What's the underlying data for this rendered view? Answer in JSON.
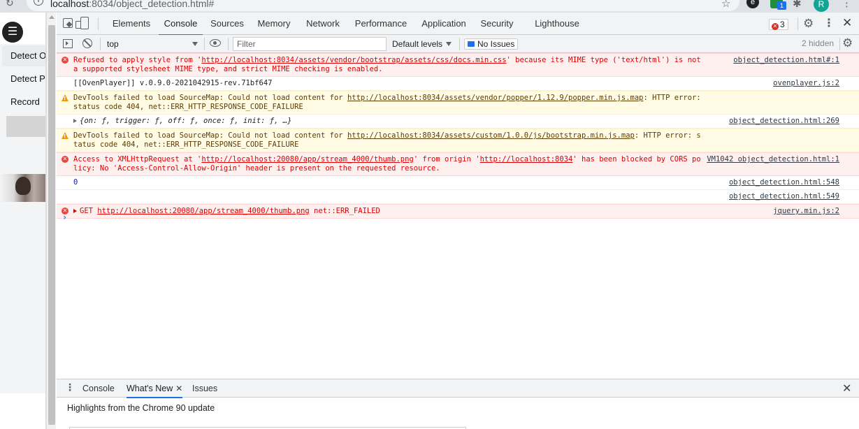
{
  "browser": {
    "url_host": "localhost",
    "url_path": ":8034/object_detection.html#",
    "profile_initial": "R",
    "extension_badge": "1"
  },
  "page": {
    "menu_items": [
      "Detect O",
      "Detect Pe",
      "Record"
    ]
  },
  "devtools": {
    "tabs": [
      "Elements",
      "Console",
      "Sources",
      "Memory",
      "Network",
      "Performance",
      "Application",
      "Security",
      "Lighthouse"
    ],
    "active_tab": "Console",
    "error_count": "3",
    "toolbar": {
      "context": "top",
      "filter_placeholder": "Filter",
      "levels": "Default levels",
      "issues": "No Issues",
      "hidden": "2 hidden"
    },
    "messages": [
      {
        "level": "error",
        "parts": [
          "Refused to apply style from '",
          "http://localhost:8034/assets/vendor/bootstrap/assets/css/docs.min.css",
          "' because its MIME type ('text/html') is not a supported stylesheet MIME type, and strict MIME checking is enabled."
        ],
        "source": "object_detection.html#:1"
      },
      {
        "level": "log",
        "parts": [
          "[[OvenPlayer]] v.0.9.0-2021042915-rev.71bf647"
        ],
        "source": "ovenplayer.js:2"
      },
      {
        "level": "warn",
        "parts": [
          "DevTools failed to load SourceMap: Could not load content for ",
          "http://localhost:8034/assets/vendor/popper/1.12.9/popper.min.js.map",
          ": HTTP error: status code 404, net::ERR_HTTP_RESPONSE_CODE_FAILURE"
        ],
        "source": ""
      },
      {
        "level": "object",
        "parts": [
          "{on: ƒ, trigger: ƒ, off: ƒ, once: ƒ, init: ƒ, …}"
        ],
        "source": "object_detection.html:269"
      },
      {
        "level": "warn",
        "parts": [
          "DevTools failed to load SourceMap: Could not load content for ",
          "http://localhost:8034/assets/custom/1.0.0/js/bootstrap.min.js.map",
          ": HTTP error: status code 404, net::ERR_HTTP_RESPONSE_CODE_FAILURE"
        ],
        "source": ""
      },
      {
        "level": "error",
        "parts": [
          "Access to XMLHttpRequest at '",
          "http://localhost:20080/app/stream_4000/thumb.png",
          "' from origin '",
          "http://localhost:8034",
          "' has been blocked by CORS policy: No 'Access-Control-Allow-Origin' header is present on the requested resource."
        ],
        "source": "VM1042 object_detection.html:1"
      },
      {
        "level": "number",
        "parts": [
          "0"
        ],
        "source": "object_detection.html:548"
      },
      {
        "level": "blank",
        "parts": [
          ""
        ],
        "source": "object_detection.html:549"
      },
      {
        "level": "error-get",
        "parts": [
          "GET ",
          "http://localhost:20080/app/stream_4000/thumb.png",
          " net::ERR_FAILED"
        ],
        "source": "jquery.min.js:2"
      }
    ],
    "drawer": {
      "tabs": [
        "Console",
        "What's New",
        "Issues"
      ],
      "active_tab": "What's New",
      "heading": "Highlights from the Chrome 90 update"
    }
  }
}
